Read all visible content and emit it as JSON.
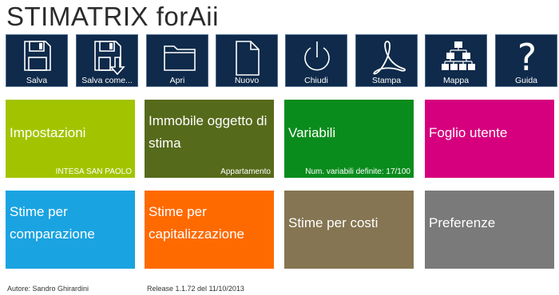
{
  "app": {
    "title": "STIMATRIX forAii"
  },
  "toolbar": {
    "buttons": [
      {
        "label": "Salva",
        "icon": "floppy-disk-icon"
      },
      {
        "label": "Salva come...",
        "icon": "floppy-disk-arrow-icon"
      },
      {
        "label": "Apri",
        "icon": "folder-icon"
      },
      {
        "label": "Nuovo",
        "icon": "new-document-icon"
      },
      {
        "label": "Chiudi",
        "icon": "power-icon"
      },
      {
        "label": "Stampa",
        "icon": "pdf-icon"
      },
      {
        "label": "Mappa",
        "icon": "sitemap-icon"
      },
      {
        "label": "Guida",
        "icon": "question-mark-icon"
      }
    ],
    "color": "#0f2a4a"
  },
  "tiles": [
    {
      "title": "Impostazioni",
      "subtitle": "INTESA SAN PAOLO",
      "color": "#a2c400"
    },
    {
      "title": "Immobile oggetto di stima",
      "subtitle": "Appartamento",
      "color": "#566a1b"
    },
    {
      "title": "Variabili",
      "subtitle": "Num. variabili definite: 17/100",
      "color": "#0a8c1c"
    },
    {
      "title": "Foglio utente",
      "subtitle": "",
      "color": "#d6007e"
    },
    {
      "title": "Stime per comparazione",
      "subtitle": "",
      "color": "#1aa3e1"
    },
    {
      "title": "Stime per capitalizzazione",
      "subtitle": "",
      "color": "#ff6a00"
    },
    {
      "title": "Stime per costi",
      "subtitle": "",
      "color": "#857552"
    },
    {
      "title": "Preferenze",
      "subtitle": "",
      "color": "#7a7a7a"
    }
  ],
  "footer": {
    "author": "Autore: Sandro Ghirardini",
    "release": "Release 1.1.72 del 11/10/2013"
  }
}
